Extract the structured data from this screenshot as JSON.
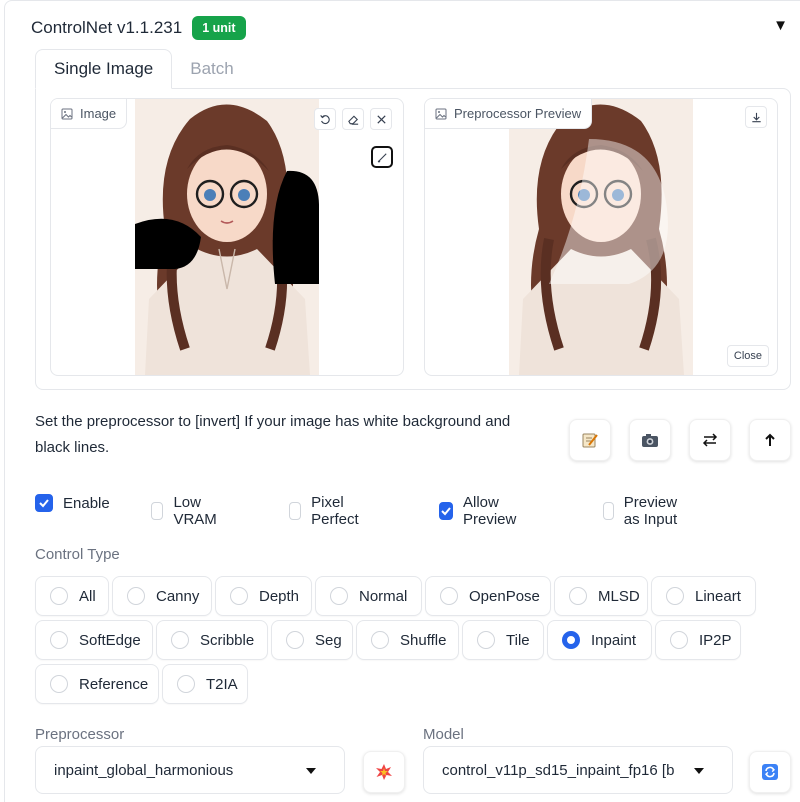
{
  "header": {
    "title": "ControlNet v1.1.231",
    "badge": "1 unit"
  },
  "tabs": [
    {
      "label": "Single Image"
    },
    {
      "label": "Batch"
    }
  ],
  "image_panel": {
    "label": "Image"
  },
  "preview_panel": {
    "label": "Preprocessor Preview",
    "close_label": "Close"
  },
  "hint": {
    "text": "Set the preprocessor to [invert] If your image has white background and black lines."
  },
  "checkboxes": [
    {
      "label": "Enable",
      "checked": true
    },
    {
      "label": "Low VRAM",
      "checked": false
    },
    {
      "label": "Pixel Perfect",
      "checked": false
    },
    {
      "label": "Allow Preview",
      "checked": true
    },
    {
      "label": "Preview as Input",
      "checked": false
    }
  ],
  "control_type": {
    "label": "Control Type",
    "options": [
      "All",
      "Canny",
      "Depth",
      "Normal",
      "OpenPose",
      "MLSD",
      "Lineart",
      "SoftEdge",
      "Scribble",
      "Seg",
      "Shuffle",
      "Tile",
      "Inpaint",
      "IP2P",
      "Reference",
      "T2IA"
    ],
    "selected": "Inpaint"
  },
  "preprocessor": {
    "label": "Preprocessor",
    "value": "inpaint_global_harmonious"
  },
  "model": {
    "label": "Model",
    "value": "control_v11p_sd15_inpaint_fp16 [b"
  },
  "colors": {
    "accent": "#2563eb",
    "badge": "#16a34a"
  }
}
